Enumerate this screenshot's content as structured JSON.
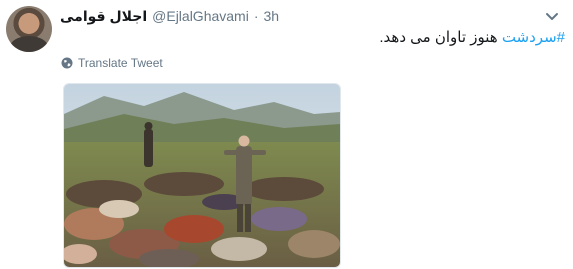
{
  "tweet": {
    "author": {
      "display_name": "اجلال قوامی",
      "handle": "@EjlalGhavami",
      "separator": "·",
      "time": "3h"
    },
    "hashtag": "#سردشت",
    "text": " هنوز تاوان می دهد.",
    "translate_label": "Translate Tweet",
    "icons": {
      "more": "chevron-down-icon",
      "translate": "globe-icon"
    },
    "colors": {
      "link": "#1da1f2",
      "muted": "#657786",
      "text": "#14171a"
    }
  }
}
